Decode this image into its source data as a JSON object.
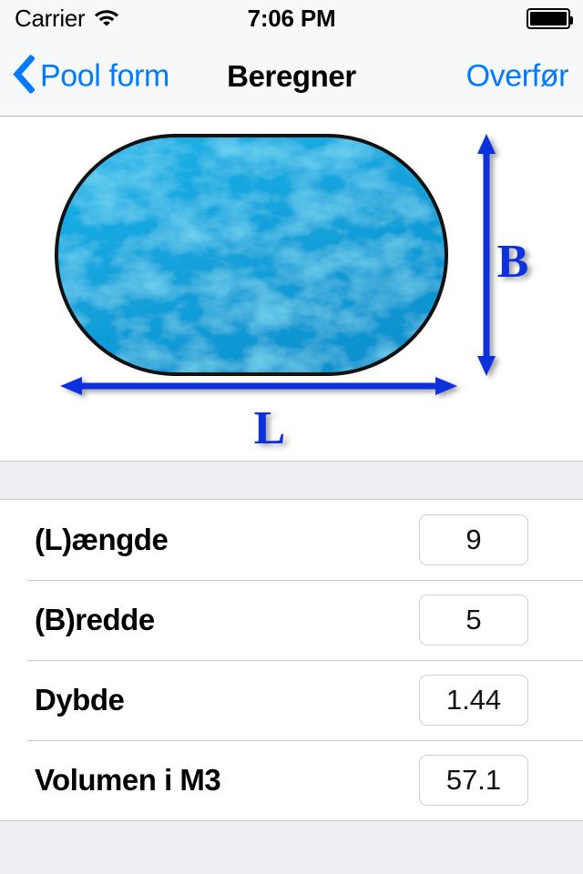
{
  "status_bar": {
    "carrier": "Carrier",
    "wifi_icon": "wifi-icon",
    "time": "7:06 PM",
    "battery_icon": "battery-full-icon"
  },
  "nav_bar": {
    "back_icon": "chevron-left-icon",
    "back_label": "Pool form",
    "title": "Beregner",
    "action_label": "Overfør",
    "tint_color": "#007aff"
  },
  "diagram": {
    "shape_name": "oblong-pool-shape",
    "water_color": "#17a8e0",
    "water_highlight_color": "#47d6f2",
    "outline_color": "#111111",
    "arrow_color": "#1133dd",
    "width_label": "B",
    "length_label": "L"
  },
  "form": {
    "rows": [
      {
        "label": "(L)ængde",
        "value": "9",
        "name": "length"
      },
      {
        "label": "(B)redde",
        "value": "5",
        "name": "width"
      },
      {
        "label": "Dybde",
        "value": "1.44",
        "name": "depth"
      },
      {
        "label": "Volumen i M3",
        "value": "57.1",
        "name": "volume"
      }
    ]
  }
}
